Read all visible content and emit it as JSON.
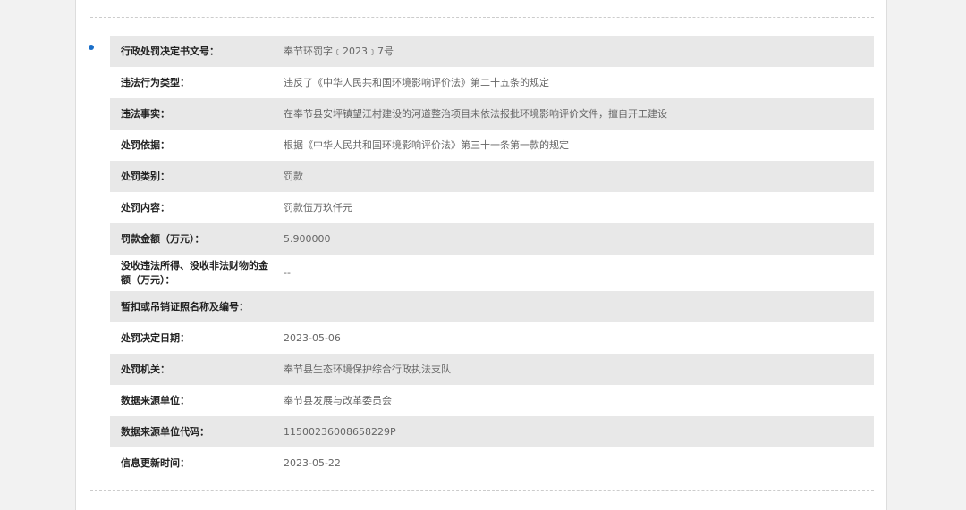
{
  "record": {
    "rows": [
      {
        "label": "行政处罚决定书文号：",
        "value": "奉节环罚字﹝2023﹞7号"
      },
      {
        "label": "违法行为类型：",
        "value": "违反了《中华人民共和国环境影响评价法》第二十五条的规定"
      },
      {
        "label": "违法事实：",
        "value": "在奉节县安坪镇望江村建设的河道整治项目未依法报批环境影响评价文件，擅自开工建设"
      },
      {
        "label": "处罚依据：",
        "value": "根据《中华人民共和国环境影响评价法》第三十一条第一款的规定"
      },
      {
        "label": "处罚类别：",
        "value": "罚款"
      },
      {
        "label": "处罚内容：",
        "value": "罚款伍万玖仟元"
      },
      {
        "label": "罚款金额（万元）：",
        "value": "5.900000"
      },
      {
        "label": "没收违法所得、没收非法财物的金额（万元）：",
        "value": "--"
      },
      {
        "label": "暂扣或吊销证照名称及编号：",
        "value": ""
      },
      {
        "label": "处罚决定日期：",
        "value": "2023-05-06"
      },
      {
        "label": "处罚机关：",
        "value": "奉节县生态环境保护综合行政执法支队"
      },
      {
        "label": "数据来源单位：",
        "value": "奉节县发展与改革委员会"
      },
      {
        "label": "数据来源单位代码：",
        "value": "11500236008658229P"
      },
      {
        "label": "信息更新时间：",
        "value": "2023-05-22"
      }
    ]
  },
  "colors": {
    "bullet": "#1a6fc9",
    "row_shade": "#e8e8e8",
    "label_text": "#222222",
    "value_text": "#666666"
  }
}
